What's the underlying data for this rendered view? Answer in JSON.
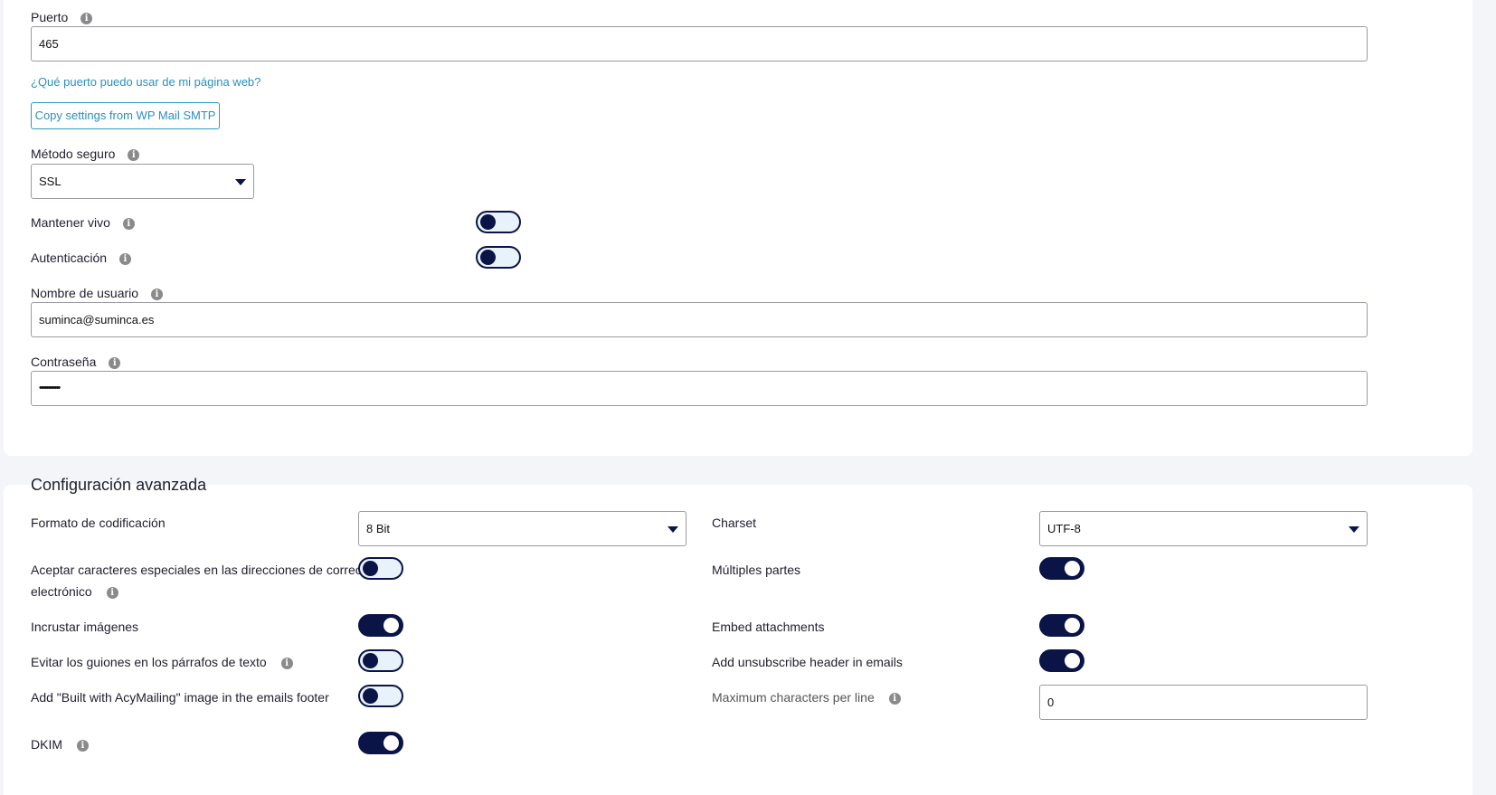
{
  "smtp": {
    "port": {
      "label": "Puerto",
      "value": "465"
    },
    "port_help_link": "¿Qué puerto puedo usar de mi página web?",
    "copy_button": "Copy settings from WP Mail SMTP",
    "secure_method": {
      "label": "Método seguro",
      "value": "SSL"
    },
    "keep_alive": {
      "label": "Mantener vivo",
      "on": false
    },
    "authentication": {
      "label": "Autenticación",
      "on": false
    },
    "username": {
      "label": "Nombre de usuario",
      "value": "suminca@suminca.es"
    },
    "password": {
      "label": "Contraseña",
      "value": "••••••••••••"
    }
  },
  "advanced": {
    "title": "Configuración avanzada",
    "encoding": {
      "label": "Formato de codificación",
      "value": "8 Bit"
    },
    "charset": {
      "label": "Charset",
      "value": "UTF-8"
    },
    "special_chars": {
      "label_line1": "Aceptar caracteres especiales en las direcciones de correo",
      "label_line2": "electrónico",
      "on": false
    },
    "multipart": {
      "label": "Múltiples partes",
      "on": true
    },
    "embed_images": {
      "label": "Incrustar imágenes",
      "on": true
    },
    "embed_attachments": {
      "label": "Embed attachments",
      "on": true
    },
    "avoid_hyphens": {
      "label": "Evitar los guiones en los párrafos de texto",
      "on": false
    },
    "unsubscribe_header": {
      "label": "Add unsubscribe header in emails",
      "on": true
    },
    "built_with_image": {
      "label": "Add \"Built with AcyMailing\" image in the emails footer",
      "on": false
    },
    "max_chars": {
      "label": "Maximum characters per line",
      "value": "0"
    },
    "dkim": {
      "label": "DKIM",
      "on": true
    }
  },
  "icons": {
    "info": "info-icon",
    "caret": "caret-down-icon"
  },
  "colors": {
    "accent": "#0b1446",
    "link": "#2a8fbd",
    "toggle_off_bg": "#e8f2fa"
  }
}
